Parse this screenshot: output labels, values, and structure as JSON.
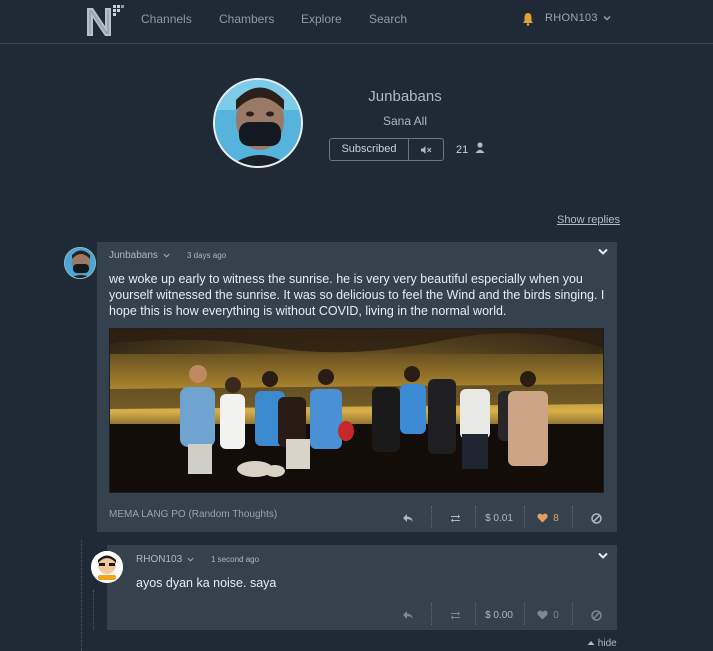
{
  "nav": {
    "links": [
      "Channels",
      "Chambers",
      "Explore",
      "Search"
    ],
    "username": "RHON103"
  },
  "profile": {
    "name": "Junbabans",
    "subtitle": "Sana All",
    "subscribe_label": "Subscribed",
    "subscriber_count": "21"
  },
  "show_replies_label": "Show replies",
  "post": {
    "author": "Junbabans",
    "time": "3 days ago",
    "text": "we woke up early to witness the sunrise. he is very very beautiful especially when you yourself witnessed the sunrise. It was so delicious to feel the Wind and the birds singing. I hope this is how everything is without COVID, living in the normal world.",
    "channel": "MEMA LANG PO (Random Thoughts)",
    "value": "$ 0.01",
    "likes": "8"
  },
  "reply": {
    "author": "RHON103",
    "time": "1 second ago",
    "text": "ayos dyan ka noise. saya",
    "value": "$ 0.00",
    "likes": "0"
  },
  "hide_label": "hide",
  "colors": {
    "background": "#1f2a36",
    "card": "#36414e",
    "bell": "#e0a23a",
    "heart_active": "#e0a060"
  },
  "icons": [
    "n-logo",
    "bell-icon",
    "chevron-down-icon",
    "mute-icon",
    "person-icon",
    "reply-icon",
    "remind-icon",
    "heart-icon",
    "block-icon",
    "caret-up-icon"
  ]
}
